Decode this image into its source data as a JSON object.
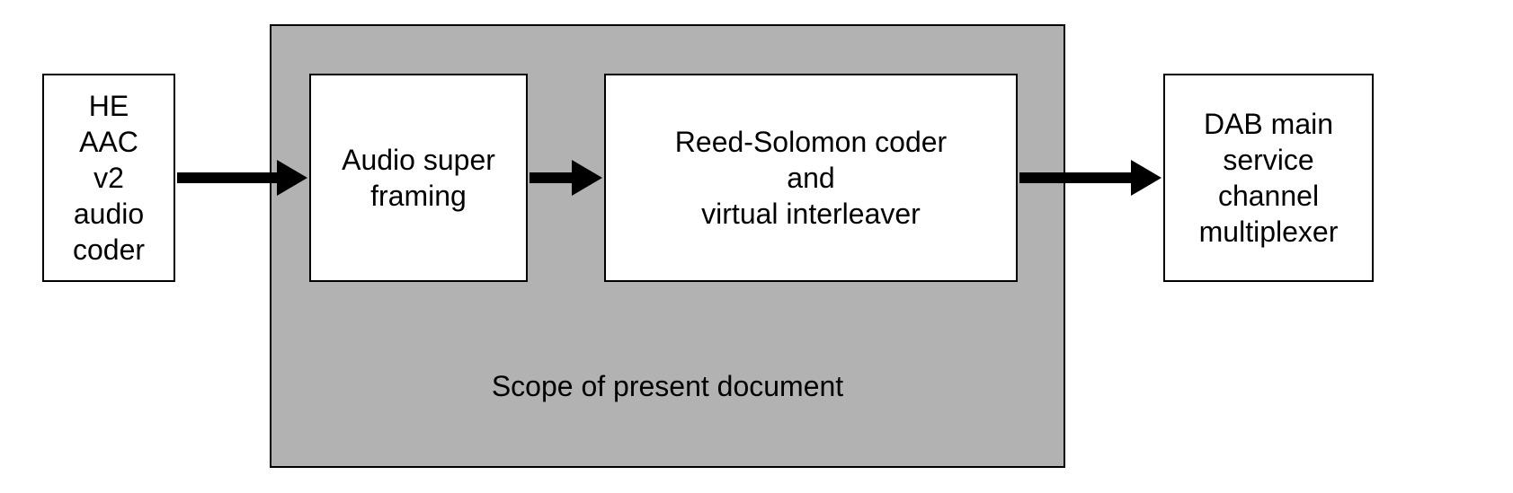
{
  "blocks": {
    "he_aac": "HE\nAAC\nv2\naudio\ncoder",
    "audio_super_framing": "Audio super\nframing",
    "reed_solomon": "Reed-Solomon coder\nand\nvirtual interleaver",
    "dab_main": "DAB main\nservice\nchannel\nmultiplexer"
  },
  "scope_caption": "Scope of present document"
}
